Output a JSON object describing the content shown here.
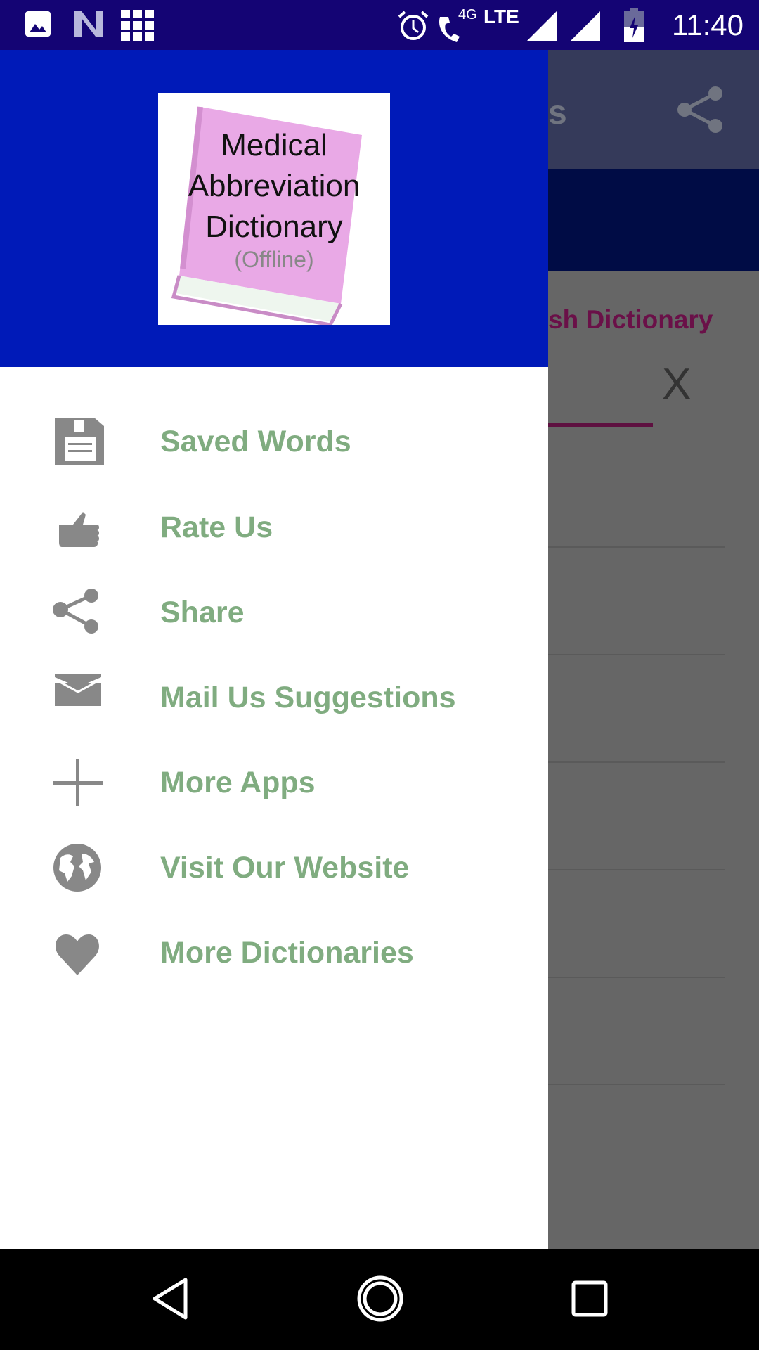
{
  "status_bar": {
    "time": "11:40",
    "network": "LTE",
    "call_badge": "4G"
  },
  "background_app": {
    "title_fragment": "s",
    "subtitle_fragment": "sh Dictionary",
    "clear_button": "X"
  },
  "drawer": {
    "logo": {
      "line1": "Medical",
      "line2": "Abbreviation",
      "line3": "Dictionary",
      "line4": "(Offline)"
    },
    "items": [
      {
        "label": "Saved Words",
        "icon": "save-icon"
      },
      {
        "label": "Rate Us",
        "icon": "thumbs-up-icon"
      },
      {
        "label": "Share",
        "icon": "share-icon"
      },
      {
        "label": "Mail Us Suggestions",
        "icon": "mail-icon"
      },
      {
        "label": "More Apps",
        "icon": "plus-icon"
      },
      {
        "label": "Visit Our Website",
        "icon": "globe-icon"
      },
      {
        "label": "More Dictionaries",
        "icon": "heart-icon"
      }
    ]
  },
  "colors": {
    "drawer_header": "#001ab8",
    "status_bar": "#140474",
    "menu_text": "#80ac80",
    "icon": "#888888"
  }
}
